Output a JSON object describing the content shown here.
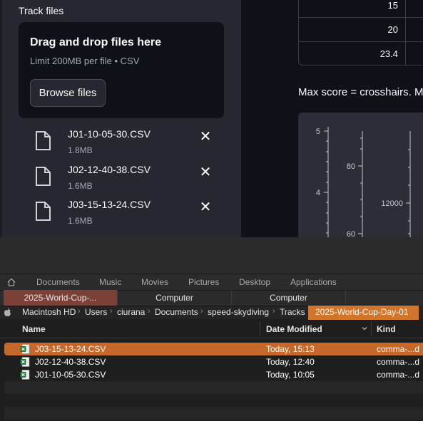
{
  "sidebar": {
    "section_title": "Track files",
    "dropzone": {
      "title": "Drag and drop files here",
      "limit": "Limit 200MB per file • CSV",
      "browse_label": "Browse files"
    },
    "files": [
      {
        "name": "J01-10-05-30.CSV",
        "size": "1.8MB"
      },
      {
        "name": "J02-12-40-38.CSV",
        "size": "1.6MB"
      },
      {
        "name": "J03-15-13-24.CSV",
        "size": "1.6MB"
      }
    ],
    "remove_glyph": "✕"
  },
  "main": {
    "table_rows": [
      "15",
      "20",
      "23.4"
    ],
    "caption": "Max score = crosshairs. Ma",
    "plot": {
      "axis1_ticks": [
        "5",
        "4"
      ],
      "axis2_ticks": [
        "80",
        "60"
      ],
      "axis3_ticks": [
        "12000"
      ]
    }
  },
  "finder": {
    "favorites": [
      "Documents",
      "Music",
      "Movies",
      "Pictures",
      "Desktop",
      "Applications"
    ],
    "tabs": [
      "2025-World-Cup-...",
      "Computer",
      "Computer"
    ],
    "path": [
      "Macintosh HD",
      "Users",
      "ciurana",
      "Documents",
      "speed-skydiving",
      "Tracks"
    ],
    "path_current": "2025-World-Cup-Day-01",
    "columns": {
      "name": "Name",
      "date": "Date Modified",
      "kind": "Kind"
    },
    "rows": [
      {
        "name": "J03-15-13-24.CSV",
        "date": "Today, 15:13",
        "kind": "comma-...d",
        "selected": true
      },
      {
        "name": "J02-12-40-38.CSV",
        "date": "Today, 12:40",
        "kind": "comma-...d"
      },
      {
        "name": "J01-10-05-30.CSV",
        "date": "Today, 10:05",
        "kind": "comma-...d"
      }
    ],
    "colors": {
      "selection": "#c5682a",
      "path_active": "#d0752b",
      "active_tab": "#7b4038"
    }
  }
}
